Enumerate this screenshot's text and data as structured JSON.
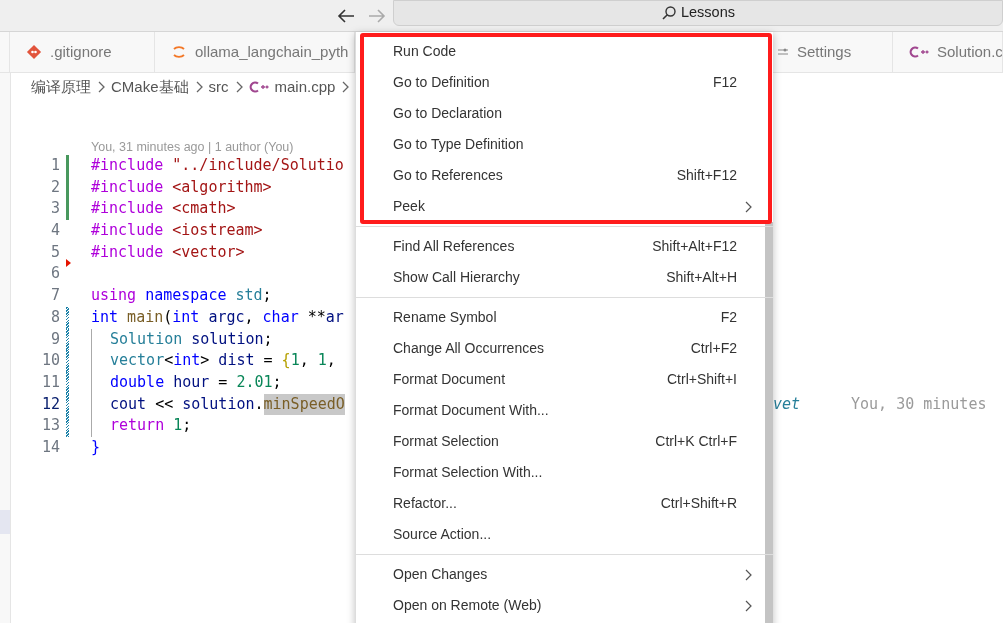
{
  "title_bar": {
    "search_label": "Lessons"
  },
  "tabs": [
    {
      "label": ".gitignore",
      "kind": "git",
      "selected": false
    },
    {
      "label": "ollama_langchain_pyth",
      "kind": "python",
      "selected": false
    },
    {
      "label": "Settings",
      "kind": "settings",
      "selected": false
    },
    {
      "label": "Solution.c",
      "kind": "cpp",
      "selected": false
    }
  ],
  "breadcrumb": [
    {
      "label": "编译原理",
      "kind": "folder"
    },
    {
      "label": "CMake基础",
      "kind": "folder"
    },
    {
      "label": "src",
      "kind": "folder"
    },
    {
      "label": "main.cpp",
      "kind": "cpp"
    }
  ],
  "blame_header": "You, 31 minutes ago | 1 author (You)",
  "code_lines": [
    {
      "number": "1",
      "marker": {
        "kind": "added"
      },
      "current": false,
      "indented": false,
      "tokens": [
        {
          "text": "#include",
          "kind": "directive"
        },
        {
          "text": " \"../include/Solutio",
          "kind": "string"
        }
      ]
    },
    {
      "number": "2",
      "marker": {
        "kind": "added"
      },
      "current": false,
      "indented": false,
      "tokens": [
        {
          "text": "#include",
          "kind": "directive"
        },
        {
          "text": " <algorithm>",
          "kind": "string"
        }
      ]
    },
    {
      "number": "3",
      "marker": {
        "kind": "added"
      },
      "current": false,
      "indented": false,
      "tokens": [
        {
          "text": "#include",
          "kind": "directive"
        },
        {
          "text": " <cmath>",
          "kind": "string"
        }
      ]
    },
    {
      "number": "4",
      "current": false,
      "indented": false,
      "tokens": [
        {
          "text": "#include",
          "kind": "directive"
        },
        {
          "text": " <iostream>",
          "kind": "string"
        }
      ]
    },
    {
      "number": "5",
      "current": false,
      "indented": false,
      "tokens": [
        {
          "text": "#include",
          "kind": "directive"
        },
        {
          "text": " <vector>",
          "kind": "string"
        }
      ]
    },
    {
      "number": "6",
      "marker": {
        "kind": "deleted"
      },
      "current": false,
      "indented": false
    },
    {
      "number": "7",
      "current": false,
      "indented": false,
      "tokens": [
        {
          "text": "using",
          "kind": "directive"
        },
        {
          "text": " namespace",
          "kind": "keyword"
        },
        {
          "text": " std",
          "kind": "type"
        },
        {
          "text": ";",
          "kind": "plain"
        }
      ]
    },
    {
      "number": "8",
      "marker": {
        "kind": "modified"
      },
      "current": false,
      "indented": false,
      "tokens": [
        {
          "text": "int",
          "kind": "keyword"
        },
        {
          "text": " main",
          "kind": "function"
        },
        {
          "text": "(",
          "kind": "plain"
        },
        {
          "text": "int",
          "kind": "keyword"
        },
        {
          "text": " argc",
          "kind": "variable"
        },
        {
          "text": ",",
          "kind": "plain"
        },
        {
          "text": " char",
          "kind": "keyword"
        },
        {
          "text": " **",
          "kind": "plain"
        },
        {
          "text": "ar",
          "kind": "variable"
        }
      ]
    },
    {
      "number": "9",
      "marker": {
        "kind": "modified"
      },
      "current": false,
      "indented": true,
      "tokens": [
        {
          "text": "Solution",
          "kind": "type"
        },
        {
          "text": " solution",
          "kind": "variable"
        },
        {
          "text": ";",
          "kind": "plain"
        }
      ]
    },
    {
      "number": "10",
      "marker": {
        "kind": "modified"
      },
      "current": false,
      "indented": true,
      "tokens": [
        {
          "text": "vector",
          "kind": "type"
        },
        {
          "text": "<",
          "kind": "plain"
        },
        {
          "text": "int",
          "kind": "keyword"
        },
        {
          "text": ">",
          "kind": "plain"
        },
        {
          "text": " dist",
          "kind": "variable"
        },
        {
          "text": " =",
          "kind": "plain"
        },
        {
          "text": " {",
          "kind": "bracket"
        },
        {
          "text": "1",
          "kind": "number"
        },
        {
          "text": ",",
          "kind": "plain"
        },
        {
          "text": " 1",
          "kind": "number"
        },
        {
          "text": ",",
          "kind": "plain"
        }
      ]
    },
    {
      "number": "11",
      "marker": {
        "kind": "modified"
      },
      "current": false,
      "indented": true,
      "tokens": [
        {
          "text": "double",
          "kind": "keyword"
        },
        {
          "text": " hour",
          "kind": "variable"
        },
        {
          "text": " =",
          "kind": "plain"
        },
        {
          "text": " 2.01",
          "kind": "number"
        },
        {
          "text": ";",
          "kind": "plain"
        }
      ]
    },
    {
      "number": "12",
      "marker": {
        "kind": "modified"
      },
      "current": true,
      "indented": true,
      "tokens": [
        {
          "text": "cout",
          "kind": "variable"
        },
        {
          "text": " <<",
          "kind": "plain"
        },
        {
          "text": " solution",
          "kind": "variable"
        },
        {
          "text": ".",
          "kind": "plain"
        },
        {
          "text": "minSpeedO",
          "kind": "highlight"
        }
      ],
      "after_menu": "vet",
      "blame": "You, 30 minutes"
    },
    {
      "number": "13",
      "marker": {
        "kind": "modified"
      },
      "current": false,
      "indented": true,
      "tokens": [
        {
          "text": "return",
          "kind": "directive"
        },
        {
          "text": " 1",
          "kind": "number"
        },
        {
          "text": ";",
          "kind": "plain"
        }
      ]
    },
    {
      "number": "14",
      "current": false,
      "indented": false,
      "tokens": [
        {
          "text": "}",
          "kind": "keyword"
        }
      ]
    }
  ],
  "context_menu": {
    "groups": [
      {
        "highlighted": true,
        "items": [
          {
            "label": "Run Code",
            "submenu": false
          },
          {
            "label": "Go to Definition",
            "shortcut": "F12",
            "submenu": false
          },
          {
            "label": "Go to Declaration",
            "submenu": false
          },
          {
            "label": "Go to Type Definition",
            "submenu": false
          },
          {
            "label": "Go to References",
            "shortcut": "Shift+F12",
            "submenu": false
          },
          {
            "label": "Peek",
            "submenu": true
          }
        ]
      },
      {
        "highlighted": false,
        "items": [
          {
            "label": "Find All References",
            "shortcut": "Shift+Alt+F12",
            "submenu": false
          },
          {
            "label": "Show Call Hierarchy",
            "shortcut": "Shift+Alt+H",
            "submenu": false
          }
        ]
      },
      {
        "highlighted": false,
        "items": [
          {
            "label": "Rename Symbol",
            "shortcut": "F2",
            "submenu": false
          },
          {
            "label": "Change All Occurrences",
            "shortcut": "Ctrl+F2",
            "submenu": false
          },
          {
            "label": "Format Document",
            "shortcut": "Ctrl+Shift+I",
            "submenu": false
          },
          {
            "label": "Format Document With...",
            "submenu": false
          },
          {
            "label": "Format Selection",
            "shortcut": "Ctrl+K Ctrl+F",
            "submenu": false
          },
          {
            "label": "Format Selection With...",
            "submenu": false
          },
          {
            "label": "Refactor...",
            "shortcut": "Ctrl+Shift+R",
            "submenu": false
          },
          {
            "label": "Source Action...",
            "submenu": false
          }
        ]
      },
      {
        "highlighted": false,
        "items": [
          {
            "label": "Open Changes",
            "submenu": true
          },
          {
            "label": "Open on Remote (Web)",
            "submenu": true
          }
        ]
      }
    ]
  }
}
